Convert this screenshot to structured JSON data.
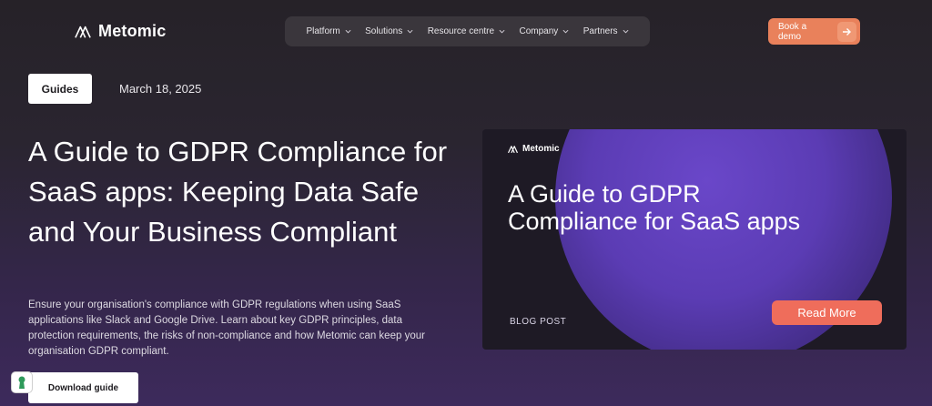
{
  "header": {
    "brand": "Metomic",
    "nav": [
      {
        "label": "Platform"
      },
      {
        "label": "Solutions"
      },
      {
        "label": "Resource centre"
      },
      {
        "label": "Company"
      },
      {
        "label": "Partners"
      }
    ],
    "cta_label": "Book a demo"
  },
  "article": {
    "tag": "Guides",
    "date": "March 18, 2025",
    "title": "A Guide to GDPR Compliance for SaaS apps: Keeping Data Safe and Your Business Compliant",
    "description": "Ensure your organisation's compliance with GDPR regulations when using SaaS applications like Slack and Google Drive. Learn about key GDPR principles, data protection requirements, the risks of non-compliance and how Metomic can keep your organisation GDPR compliant.",
    "download_label": "Download guide"
  },
  "card": {
    "brand": "Metomic",
    "title": "A Guide to GDPR Compliance for SaaS apps",
    "kicker": "BLOG POST",
    "button_label": "Read More"
  },
  "colors": {
    "accent": "#e9815b",
    "card_button": "#ef6d5b",
    "card_circle": "#5b3cb4"
  }
}
